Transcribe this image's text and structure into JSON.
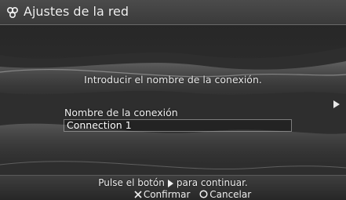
{
  "header": {
    "title": "Ajustes de la red",
    "icon": "network-settings-icon"
  },
  "main": {
    "instruction": "Introducir el nombre de la conexión.",
    "field_label": "Nombre de la conexión",
    "field_value": "Connection 1"
  },
  "footer": {
    "hint_before": "Pulse el botón",
    "hint_after": "para continuar.",
    "confirm_label": "Confirmar",
    "cancel_label": "Cancelar"
  },
  "colors": {
    "background": "#262626",
    "text": "#f0f0f0"
  }
}
